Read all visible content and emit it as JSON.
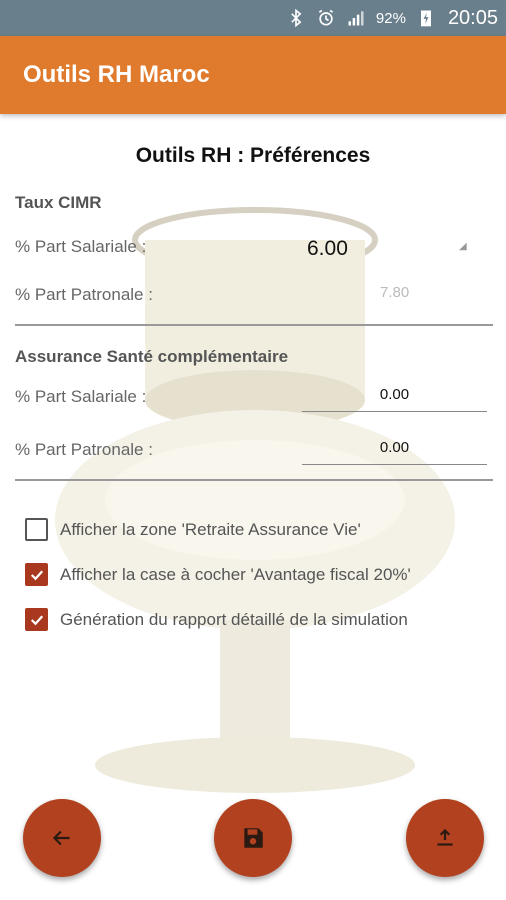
{
  "status_bar": {
    "icons": [
      "bluetooth-icon",
      "alarm-icon",
      "signal-icon",
      "battery-charging-icon"
    ],
    "battery": "92%",
    "time": "20:05"
  },
  "app_bar": {
    "title": "Outils RH Maroc"
  },
  "page_title": "Outils RH : Préférences",
  "cimr": {
    "title": "Taux CIMR",
    "salariale_label": "% Part Salariale :",
    "salariale_value": "6.00",
    "patronale_label": "% Part Patronale :",
    "patronale_value": "7.80"
  },
  "assurance": {
    "title": "Assurance Santé complémentaire",
    "salariale_label": "% Part Salariale :",
    "salariale_value": "0.00",
    "patronale_label": "% Part Patronale :",
    "patronale_value": "0.00"
  },
  "options": [
    {
      "label": "Afficher la zone 'Retraite Assurance Vie'",
      "checked": false
    },
    {
      "label": "Afficher la case à cocher 'Avantage fiscal 20%'",
      "checked": true
    },
    {
      "label": "Génération du rapport détaillé de la simulation",
      "checked": true
    }
  ],
  "fabs": {
    "back_icon": "arrow-back-icon",
    "save_icon": "save-icon",
    "share_icon": "upload-icon"
  },
  "colors": {
    "status_bar": "#6a7f8c",
    "app_bar": "#e07a2c",
    "accent": "#b1411f",
    "checkbox": "#a8391f"
  }
}
